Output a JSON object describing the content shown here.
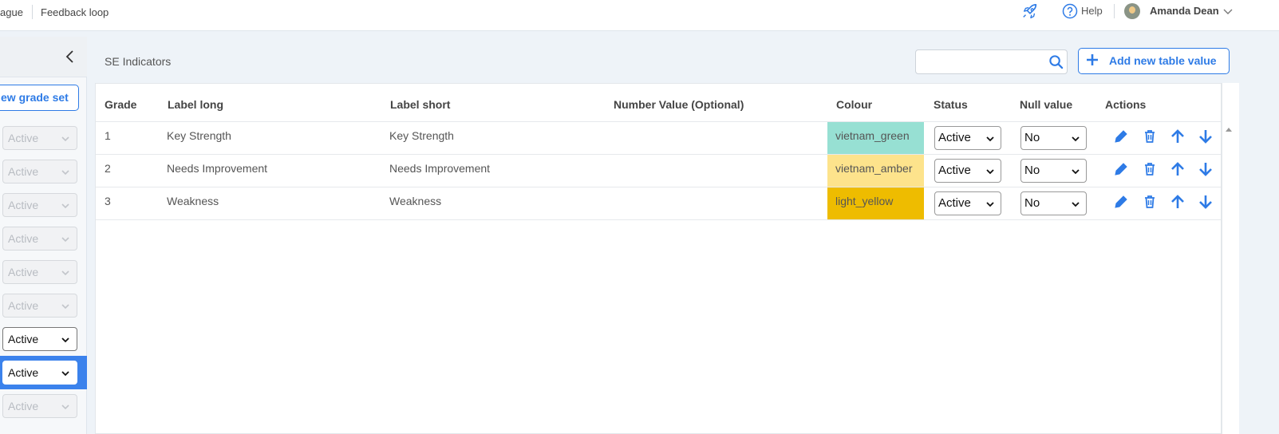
{
  "breadcrumbs": [
    "ague",
    "Feedback loop"
  ],
  "topbar": {
    "help_label": "Help",
    "user_name": "Amanda Dean"
  },
  "sidebar": {
    "new_grade_button": "ew grade set",
    "status_items": [
      {
        "label": "Active",
        "enabled": false
      },
      {
        "label": "Active",
        "enabled": false
      },
      {
        "label": "Active",
        "enabled": false
      },
      {
        "label": "Active",
        "enabled": false
      },
      {
        "label": "Active",
        "enabled": false
      },
      {
        "label": "Active",
        "enabled": false
      },
      {
        "label": "Active",
        "enabled": true
      },
      {
        "label": "Active",
        "enabled": true,
        "highlighted": true
      },
      {
        "label": "Active",
        "enabled": false
      }
    ]
  },
  "main": {
    "title": "SE Indicators",
    "search_placeholder": "",
    "add_button": "Add new table value"
  },
  "table": {
    "headers": {
      "grade": "Grade",
      "label_long": "Label long",
      "label_short": "Label short",
      "number_value": "Number Value (Optional)",
      "colour": "Colour",
      "status": "Status",
      "null_value": "Null value",
      "actions": "Actions"
    },
    "rows": [
      {
        "grade": "1",
        "label_long": "Key Strength",
        "label_short": "Key Strength",
        "number_value": "",
        "colour": "vietnam_green",
        "colour_hex": "#97e0d3",
        "status": "Active",
        "null_value": "No"
      },
      {
        "grade": "2",
        "label_long": "Needs Improvement",
        "label_short": "Needs Improvement",
        "number_value": "",
        "colour": "vietnam_amber",
        "colour_hex": "#fde38c",
        "status": "Active",
        "null_value": "No"
      },
      {
        "grade": "3",
        "label_long": "Weakness",
        "label_short": "Weakness",
        "number_value": "",
        "colour": "light_yellow",
        "colour_hex": "#eebc00",
        "status": "Active",
        "null_value": "No"
      }
    ]
  },
  "colors": {
    "accent": "#2e7be6",
    "highlight": "#3b82ec"
  }
}
